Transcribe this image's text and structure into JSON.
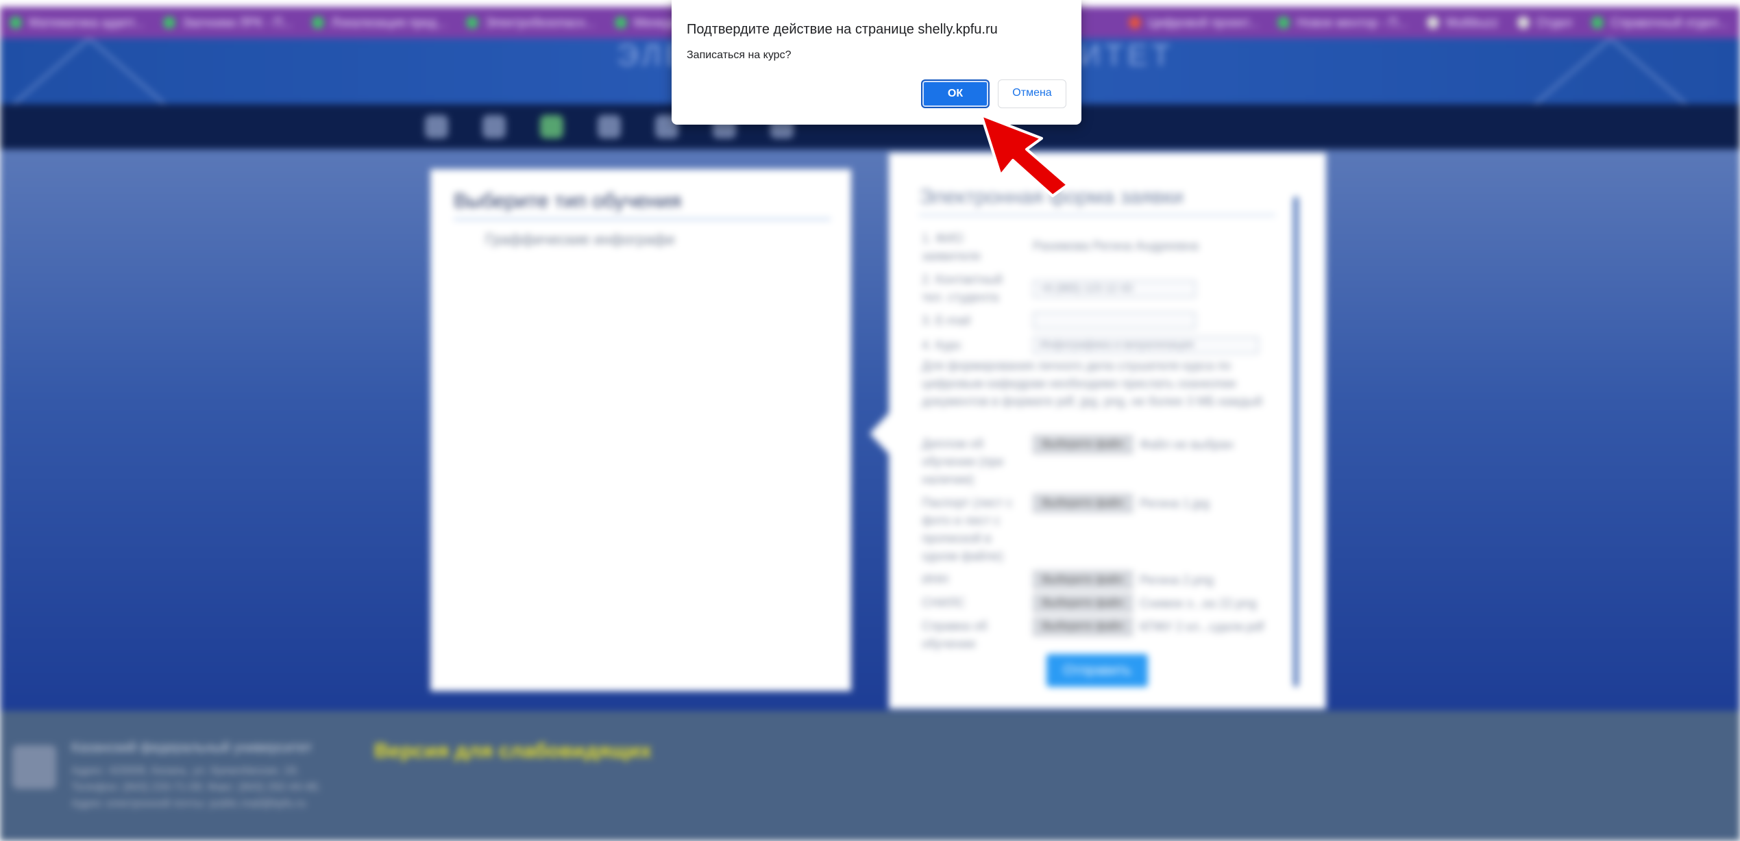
{
  "bookmarks": [
    {
      "label": "Математика адапт..."
    },
    {
      "label": "Заочники ЛРК - П..."
    },
    {
      "label": "Локализация пред..."
    },
    {
      "label": "Электробезопасн..."
    },
    {
      "label": "Менеджмент в жив..."
    },
    {
      "label": "Цифровой проект..."
    },
    {
      "label": "Новое ментор - П..."
    },
    {
      "label": "Multibuzz"
    },
    {
      "label": "Отдел"
    },
    {
      "label": "Справочный отдел..."
    }
  ],
  "banner": {
    "title": "ЭЛЕКТРОННЫЙ УНИВЕРСИТЕТ"
  },
  "left_card": {
    "heading": "Выберите тип обучения",
    "item": "Граффические инфографи"
  },
  "right_card": {
    "heading": "Электронная форма заявки",
    "fields": [
      {
        "label": "1. ФИО заявителя",
        "value": "Рахимова Регина Андреевна"
      },
      {
        "label": "2. Контактный тел. студента",
        "value": "+8 (965) 123 12 43"
      },
      {
        "label": "3. E-mail",
        "value": ""
      },
      {
        "label": "4. Курс",
        "value": "Инфографика и визуализация"
      }
    ],
    "note": "Для формирования личного дела слушателя курса по цифровым кафедрам необходимо прислать сканкопии документов в формате pdf, jpg, png, не более 3 МБ каждый",
    "files": [
      {
        "label": "Диплом об обучении (при наличии)",
        "button": "Выберите файл",
        "file": "Файл не выбран"
      },
      {
        "label": "Паспорт (лист с фото и лист с пропиской в одном файле)",
        "button": "Выберите файл",
        "file": "Регина 1.jpg"
      },
      {
        "label": "ИНН",
        "button": "Выберите файл",
        "file": "Регина 2.png"
      },
      {
        "label": "СНИЛС",
        "button": "Выберите файл",
        "file": "Снимок э...ка 22.png"
      },
      {
        "label": "Справка об обучении",
        "button": "Выберите файл",
        "file": "КПФУ 2 кл...сдали.pdf"
      }
    ],
    "submit": "Отправить"
  },
  "footer": {
    "org": "Казанский федеральный университет",
    "contact": "Адрес: 420008, Казань, ул. Кремлёвская, 18; Телефон: (843) 233-71-09; Факс: (843) 292-44-48; Адрес электронной почты: public.mail@kpfu.ru",
    "accessibility": "Версия для слабовидящих"
  },
  "dialog": {
    "title": "Подтвердите действие на странице shelly.kpfu.ru",
    "message": "Записаться на курс?",
    "ok": "ОК",
    "cancel": "Отмена"
  },
  "colors": {
    "accent": "#1a73e8",
    "bookmarks_bar": "#7a3fa8",
    "annotation_arrow": "#e60000"
  }
}
